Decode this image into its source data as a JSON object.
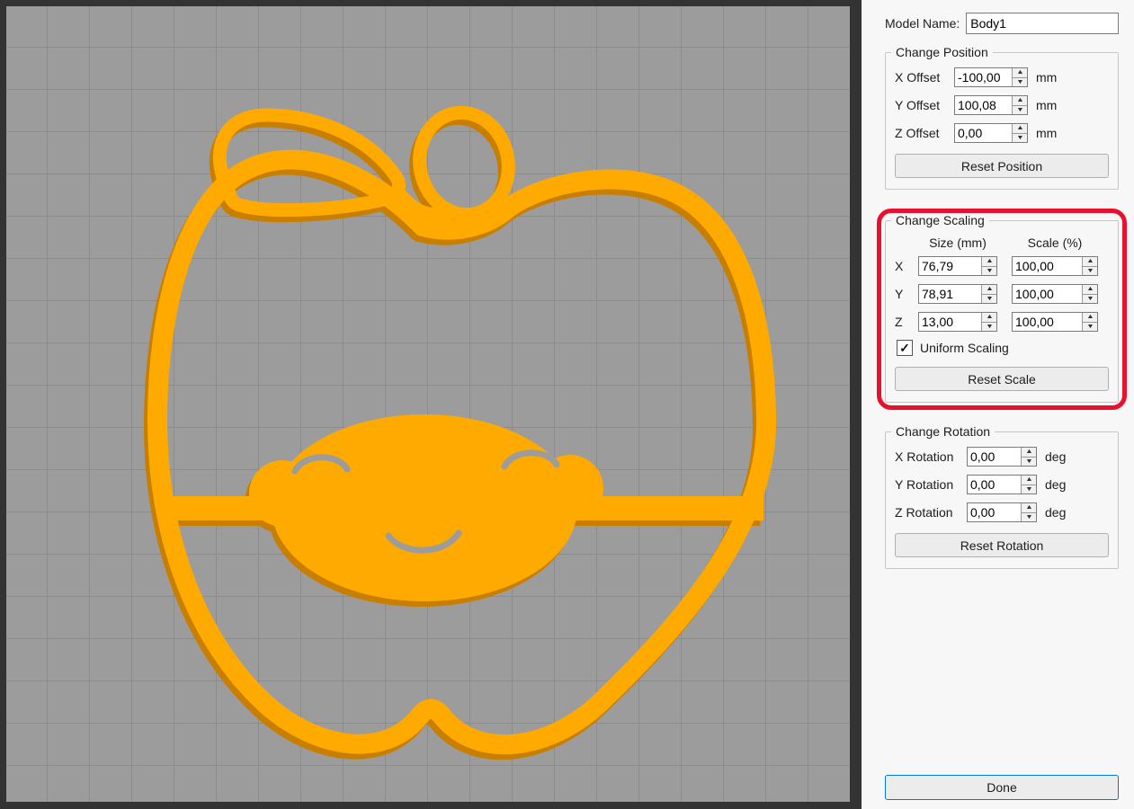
{
  "viewport": {
    "colors": {
      "model": "#FFAA00",
      "model_shade": "#C87E00",
      "background": "#9C9C9C",
      "grid_line": "#8C8C8C",
      "frame": "#333333"
    }
  },
  "icons": {
    "spin_up": "▲",
    "spin_down": "▼",
    "check": "✓"
  },
  "annotation": {
    "color": "#E8112D",
    "target": "Change Scaling"
  },
  "panel": {
    "model_name": {
      "label": "Model Name:",
      "value": "Body1"
    },
    "position": {
      "title": "Change Position",
      "rows": [
        {
          "label": "X Offset",
          "value": "-100,00",
          "unit": "mm"
        },
        {
          "label": "Y Offset",
          "value": "100,08",
          "unit": "mm"
        },
        {
          "label": "Z Offset",
          "value": "0,00",
          "unit": "mm"
        }
      ],
      "reset_label": "Reset Position"
    },
    "scaling": {
      "title": "Change Scaling",
      "col_headers": [
        "Size (mm)",
        "Scale (%)"
      ],
      "rows": [
        {
          "label": "X",
          "size": "76,79",
          "scale": "100,00"
        },
        {
          "label": "Y",
          "size": "78,91",
          "scale": "100,00"
        },
        {
          "label": "Z",
          "size": "13,00",
          "scale": "100,00"
        }
      ],
      "uniform_label": "Uniform Scaling",
      "uniform_checked": true,
      "reset_label": "Reset Scale"
    },
    "rotation": {
      "title": "Change Rotation",
      "rows": [
        {
          "label": "X Rotation",
          "value": "0,00",
          "unit": "deg"
        },
        {
          "label": "Y Rotation",
          "value": "0,00",
          "unit": "deg"
        },
        {
          "label": "Z Rotation",
          "value": "0,00",
          "unit": "deg"
        }
      ],
      "reset_label": "Reset Rotation"
    },
    "done_label": "Done"
  }
}
